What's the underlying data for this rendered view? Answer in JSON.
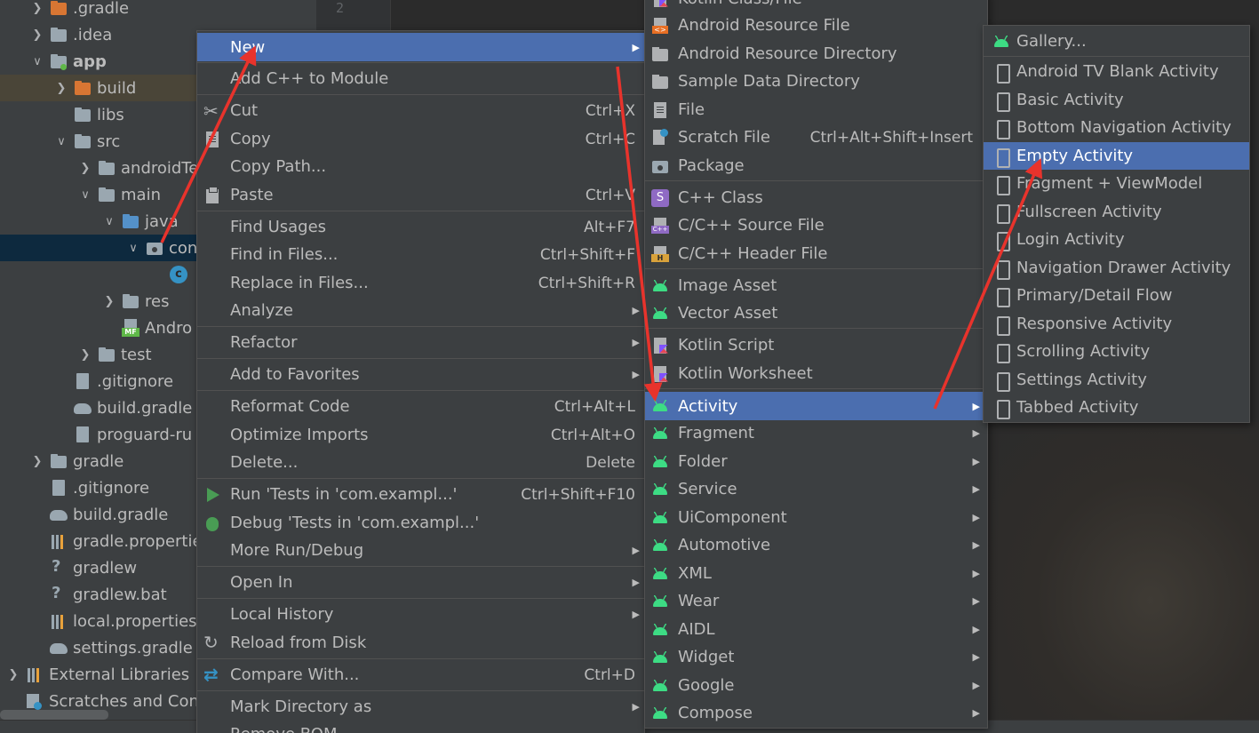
{
  "editor": {
    "line_number": "2"
  },
  "tree": {
    "rows": [
      {
        "label": ".gradle",
        "icon": "folder-orange-icon",
        "chevron": "right"
      },
      {
        "label": ".idea",
        "icon": "folder-icon",
        "chevron": "right"
      },
      {
        "label": "app",
        "icon": "module-folder-icon",
        "chevron": "down"
      },
      {
        "label": "build",
        "icon": "folder-orange-icon",
        "chevron": "right"
      },
      {
        "label": "libs",
        "icon": "folder-icon",
        "chevron": ""
      },
      {
        "label": "src",
        "icon": "folder-icon",
        "chevron": "down"
      },
      {
        "label": "androidTe",
        "icon": "folder-icon",
        "chevron": "right"
      },
      {
        "label": "main",
        "icon": "folder-icon",
        "chevron": "down"
      },
      {
        "label": "java",
        "icon": "folder-blue-icon",
        "chevron": "down"
      },
      {
        "label": "con",
        "icon": "package-icon",
        "chevron": "down"
      },
      {
        "label": "",
        "icon": "kotlin-class-icon",
        "chevron": ""
      },
      {
        "label": "res",
        "icon": "res-folder-icon",
        "chevron": "right"
      },
      {
        "label": "Andro",
        "icon": "manifest-icon",
        "chevron": ""
      },
      {
        "label": "test",
        "icon": "folder-icon",
        "chevron": "right"
      },
      {
        "label": ".gitignore",
        "icon": "gitignore-icon",
        "chevron": ""
      },
      {
        "label": "build.gradle",
        "icon": "gradle-elephant-icon",
        "chevron": ""
      },
      {
        "label": "proguard-ru",
        "icon": "file-icon",
        "chevron": ""
      },
      {
        "label": "gradle",
        "icon": "folder-icon",
        "chevron": "right"
      },
      {
        "label": ".gitignore",
        "icon": "gitignore-icon",
        "chevron": ""
      },
      {
        "label": "build.gradle",
        "icon": "gradle-elephant-icon",
        "chevron": ""
      },
      {
        "label": "gradle.propertie",
        "icon": "properties-icon",
        "chevron": ""
      },
      {
        "label": "gradlew",
        "icon": "script-icon",
        "chevron": ""
      },
      {
        "label": "gradlew.bat",
        "icon": "script-icon",
        "chevron": ""
      },
      {
        "label": "local.properties",
        "icon": "properties-icon",
        "chevron": ""
      },
      {
        "label": "settings.gradle",
        "icon": "gradle-elephant-icon",
        "chevron": ""
      },
      {
        "label": "External Libraries",
        "icon": "libraries-icon",
        "chevron": "right"
      },
      {
        "label": "Scratches and Cons",
        "icon": "scratches-icon",
        "chevron": ""
      }
    ]
  },
  "context_menu": {
    "items": [
      {
        "label": "New",
        "shortcut": "",
        "submenu": true,
        "icon": "",
        "highlight": true
      },
      {
        "label": "Add C++ to Module",
        "shortcut": "",
        "submenu": false,
        "icon": ""
      },
      {
        "label": "Cut",
        "shortcut": "Ctrl+X",
        "submenu": false,
        "icon": "scissors-icon"
      },
      {
        "label": "Copy",
        "shortcut": "Ctrl+C",
        "submenu": false,
        "icon": "copy-icon"
      },
      {
        "label": "Copy Path...",
        "shortcut": "",
        "submenu": false,
        "icon": ""
      },
      {
        "label": "Paste",
        "shortcut": "Ctrl+V",
        "submenu": false,
        "icon": "paste-icon"
      },
      {
        "label": "Find Usages",
        "shortcut": "Alt+F7",
        "submenu": false,
        "icon": ""
      },
      {
        "label": "Find in Files...",
        "shortcut": "Ctrl+Shift+F",
        "submenu": false,
        "icon": ""
      },
      {
        "label": "Replace in Files...",
        "shortcut": "Ctrl+Shift+R",
        "submenu": false,
        "icon": ""
      },
      {
        "label": "Analyze",
        "shortcut": "",
        "submenu": true,
        "icon": ""
      },
      {
        "label": "Refactor",
        "shortcut": "",
        "submenu": true,
        "icon": ""
      },
      {
        "label": "Add to Favorites",
        "shortcut": "",
        "submenu": true,
        "icon": ""
      },
      {
        "label": "Reformat Code",
        "shortcut": "Ctrl+Alt+L",
        "submenu": false,
        "icon": ""
      },
      {
        "label": "Optimize Imports",
        "shortcut": "Ctrl+Alt+O",
        "submenu": false,
        "icon": ""
      },
      {
        "label": "Delete...",
        "shortcut": "Delete",
        "submenu": false,
        "icon": ""
      },
      {
        "label": "Run 'Tests in 'com.exampl...'",
        "shortcut": "Ctrl+Shift+F10",
        "submenu": false,
        "icon": "run-icon"
      },
      {
        "label": "Debug 'Tests in 'com.exampl...'",
        "shortcut": "",
        "submenu": false,
        "icon": "debug-icon"
      },
      {
        "label": "More Run/Debug",
        "shortcut": "",
        "submenu": true,
        "icon": ""
      },
      {
        "label": "Open In",
        "shortcut": "",
        "submenu": true,
        "icon": ""
      },
      {
        "label": "Local History",
        "shortcut": "",
        "submenu": true,
        "icon": ""
      },
      {
        "label": "Reload from Disk",
        "shortcut": "",
        "submenu": false,
        "icon": "reload-icon"
      },
      {
        "label": "Compare With...",
        "shortcut": "Ctrl+D",
        "submenu": false,
        "icon": "compare-icon"
      },
      {
        "label": "Mark Directory as",
        "shortcut": "",
        "submenu": true,
        "icon": ""
      },
      {
        "label": "Remove BOM",
        "shortcut": "",
        "submenu": false,
        "icon": ""
      }
    ]
  },
  "new_submenu": {
    "items": [
      {
        "label": "Kotlin Class/File",
        "shortcut": "",
        "submenu": false,
        "icon": "kotlin-file-icon"
      },
      {
        "label": "Android Resource File",
        "shortcut": "",
        "submenu": false,
        "icon": "resource-file-icon"
      },
      {
        "label": "Android Resource Directory",
        "shortcut": "",
        "submenu": false,
        "icon": "folder-icon"
      },
      {
        "label": "Sample Data Directory",
        "shortcut": "",
        "submenu": false,
        "icon": "folder-icon"
      },
      {
        "label": "File",
        "shortcut": "",
        "submenu": false,
        "icon": "file-icon"
      },
      {
        "label": "Scratch File",
        "shortcut": "Ctrl+Alt+Shift+Insert",
        "submenu": false,
        "icon": "scratch-file-icon"
      },
      {
        "label": "Package",
        "shortcut": "",
        "submenu": false,
        "icon": "package-icon"
      },
      {
        "label": "C++ Class",
        "shortcut": "",
        "submenu": false,
        "icon": "cpp-class-icon"
      },
      {
        "label": "C/C++ Source File",
        "shortcut": "",
        "submenu": false,
        "icon": "cpp-source-icon"
      },
      {
        "label": "C/C++ Header File",
        "shortcut": "",
        "submenu": false,
        "icon": "cpp-header-icon"
      },
      {
        "label": "Image Asset",
        "shortcut": "",
        "submenu": false,
        "icon": "android-icon"
      },
      {
        "label": "Vector Asset",
        "shortcut": "",
        "submenu": false,
        "icon": "android-icon"
      },
      {
        "label": "Kotlin Script",
        "shortcut": "",
        "submenu": false,
        "icon": "kotlin-file-icon"
      },
      {
        "label": "Kotlin Worksheet",
        "shortcut": "",
        "submenu": false,
        "icon": "kotlin-file-icon"
      },
      {
        "label": "Activity",
        "shortcut": "",
        "submenu": true,
        "icon": "android-icon",
        "highlight": true
      },
      {
        "label": "Fragment",
        "shortcut": "",
        "submenu": true,
        "icon": "android-icon"
      },
      {
        "label": "Folder",
        "shortcut": "",
        "submenu": true,
        "icon": "android-icon"
      },
      {
        "label": "Service",
        "shortcut": "",
        "submenu": true,
        "icon": "android-icon"
      },
      {
        "label": "UiComponent",
        "shortcut": "",
        "submenu": true,
        "icon": "android-icon"
      },
      {
        "label": "Automotive",
        "shortcut": "",
        "submenu": true,
        "icon": "android-icon"
      },
      {
        "label": "XML",
        "shortcut": "",
        "submenu": true,
        "icon": "android-icon"
      },
      {
        "label": "Wear",
        "shortcut": "",
        "submenu": true,
        "icon": "android-icon"
      },
      {
        "label": "AIDL",
        "shortcut": "",
        "submenu": true,
        "icon": "android-icon"
      },
      {
        "label": "Widget",
        "shortcut": "",
        "submenu": true,
        "icon": "android-icon"
      },
      {
        "label": "Google",
        "shortcut": "",
        "submenu": true,
        "icon": "android-icon"
      },
      {
        "label": "Compose",
        "shortcut": "",
        "submenu": true,
        "icon": "android-icon"
      }
    ]
  },
  "activity_submenu": {
    "items": [
      {
        "label": "Gallery...",
        "icon": "android-icon"
      },
      {
        "label": "Android TV Blank Activity",
        "icon": "device-icon"
      },
      {
        "label": "Basic Activity",
        "icon": "device-icon"
      },
      {
        "label": "Bottom Navigation Activity",
        "icon": "device-icon"
      },
      {
        "label": "Empty Activity",
        "icon": "device-icon",
        "highlight": true
      },
      {
        "label": "Fragment + ViewModel",
        "icon": "device-icon"
      },
      {
        "label": "Fullscreen Activity",
        "icon": "device-icon"
      },
      {
        "label": "Login Activity",
        "icon": "device-icon"
      },
      {
        "label": "Navigation Drawer Activity",
        "icon": "device-icon"
      },
      {
        "label": "Primary/Detail Flow",
        "icon": "device-icon"
      },
      {
        "label": "Responsive Activity",
        "icon": "device-icon"
      },
      {
        "label": "Scrolling Activity",
        "icon": "device-icon"
      },
      {
        "label": "Settings Activity",
        "icon": "device-icon"
      },
      {
        "label": "Tabbed Activity",
        "icon": "device-icon"
      }
    ]
  },
  "colors": {
    "highlight": "#4b6eaf",
    "menu_bg": "#3c3f41",
    "annotation_arrow": "#e8332c",
    "android_green": "#3ddc84"
  }
}
